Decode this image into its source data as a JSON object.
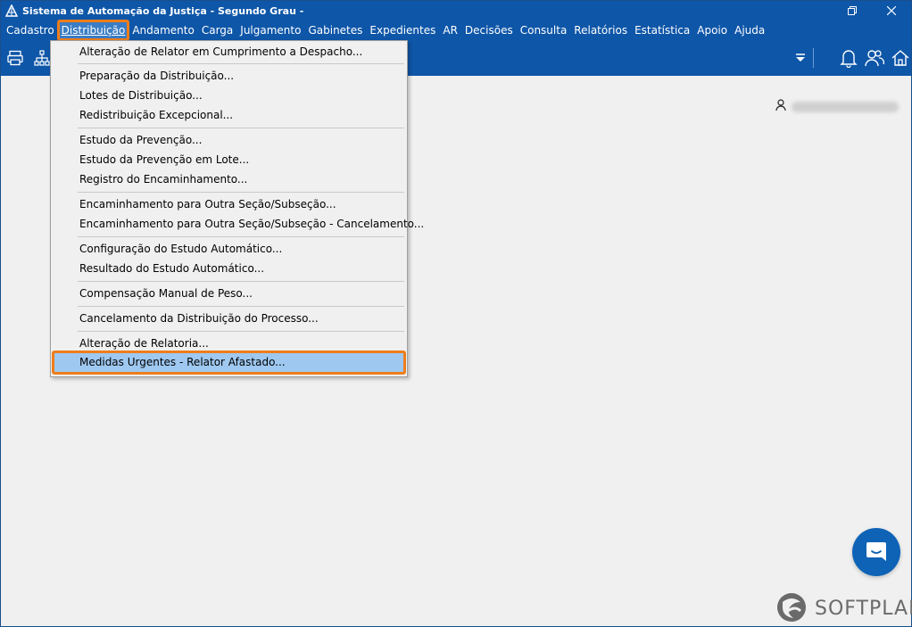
{
  "window": {
    "title": "Sistema de Automação da Justiça - Segundo Grau -"
  },
  "menubar": {
    "items": [
      {
        "label": "Cadastro"
      },
      {
        "label": "Distribuição"
      },
      {
        "label": "Andamento"
      },
      {
        "label": "Carga"
      },
      {
        "label": "Julgamento"
      },
      {
        "label": "Gabinetes"
      },
      {
        "label": "Expedientes"
      },
      {
        "label": "AR"
      },
      {
        "label": "Decisões"
      },
      {
        "label": "Consulta"
      },
      {
        "label": "Relatórios"
      },
      {
        "label": "Estatística"
      },
      {
        "label": "Apoio"
      },
      {
        "label": "Ajuda"
      }
    ],
    "active_index": 1
  },
  "toolbar": {
    "icons": [
      "printer-icon",
      "sitemap-icon",
      "dropdown-arrow-icon",
      "bell-icon",
      "users-icon",
      "home-icon"
    ]
  },
  "dropdown": {
    "items": [
      {
        "label": "Alteração de Relator em Cumprimento a Despacho..."
      },
      {
        "label": "Preparação da Distribuição..."
      },
      {
        "label": "Lotes de Distribuição..."
      },
      {
        "label": "Redistribuição Excepcional..."
      },
      {
        "label": "Estudo da Prevenção..."
      },
      {
        "label": "Estudo da Prevenção em Lote..."
      },
      {
        "label": "Registro do Encaminhamento..."
      },
      {
        "label": "Encaminhamento para Outra Seção/Subseção..."
      },
      {
        "label": "Encaminhamento para Outra Seção/Subseção - Cancelamento..."
      },
      {
        "label": "Configuração do Estudo Automático..."
      },
      {
        "label": "Resultado do Estudo Automático..."
      },
      {
        "label": "Compensação Manual de Peso..."
      },
      {
        "label": "Cancelamento da Distribuição do Processo..."
      },
      {
        "label": "Alteração de Relatoria..."
      },
      {
        "label": "Medidas Urgentes - Relator Afastado..."
      }
    ],
    "highlighted_index": 14
  },
  "user": {
    "icon": "user-icon"
  },
  "brand": {
    "name": "SOFTPLAN"
  },
  "colors": {
    "titlebar": "#0e56a8",
    "highlight_outline": "#ee7d1a",
    "highlight_fill": "#9ec8f0",
    "chat_button": "#0e63b6"
  }
}
